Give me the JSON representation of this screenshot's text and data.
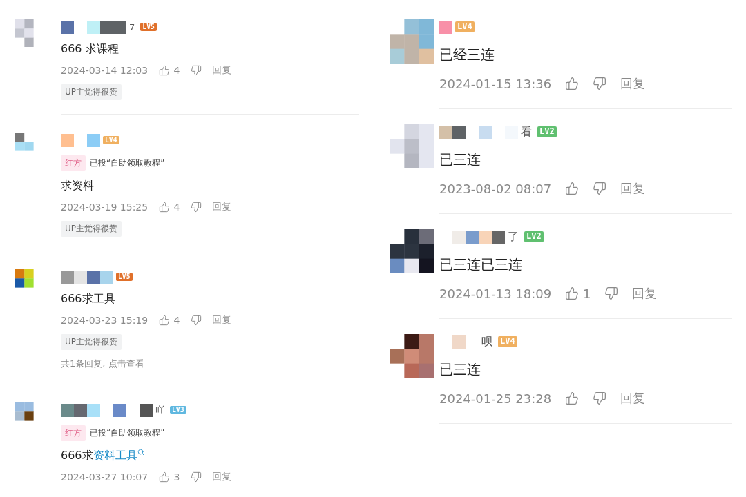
{
  "columns": [
    {
      "kind": "compact",
      "comments": [
        {
          "name_tail": "7",
          "level": {
            "label": "LV5",
            "color": "#e0702a"
          },
          "text": "666 求课程",
          "date": "2024-03-14 12:03",
          "likes": "4",
          "reply": "回复",
          "tag": "UP主觉得很赞"
        },
        {
          "level": {
            "label": "LV4",
            "color": "#f0b060"
          },
          "vote": {
            "side": "红方",
            "text": "已投“自助领取教程”"
          },
          "text": "求资料",
          "date": "2024-03-19 15:25",
          "likes": "4",
          "reply": "回复",
          "tag": "UP主觉得很赞"
        },
        {
          "level": {
            "label": "LV5",
            "color": "#e0702a"
          },
          "text": "666求工具",
          "date": "2024-03-23 15:19",
          "likes": "4",
          "reply": "回复",
          "tag": "UP主觉得很赞",
          "replies_link": "共1条回复, 点击查看"
        },
        {
          "name_tail": "吖",
          "level": {
            "label": "LV3",
            "color": "#60b8e0"
          },
          "vote": {
            "side": "红方",
            "text": "已投“自助领取教程”"
          },
          "text": "666求",
          "link": "资料工具",
          "date": "2024-03-27 10:07",
          "likes": "3",
          "reply": "回复"
        }
      ]
    },
    {
      "kind": "large",
      "comments": [
        {
          "level": {
            "label": "LV4",
            "color": "#f0b060"
          },
          "text": "已经三连",
          "date": "2024-01-15 13:36",
          "reply": "回复"
        },
        {
          "name_tail": "看",
          "level": {
            "label": "LV2",
            "color": "#60c070"
          },
          "text": "已三连",
          "date": "2023-08-02 08:07",
          "reply": "回复"
        },
        {
          "name_tail": "了",
          "level": {
            "label": "LV2",
            "color": "#60c070"
          },
          "text": "已三连已三连",
          "date": "2024-01-13 18:09",
          "likes": "1",
          "reply": "回复"
        },
        {
          "name_tail": "呗",
          "level": {
            "label": "LV4",
            "color": "#f0b060"
          },
          "text": "已三连",
          "date": "2024-01-25 23:28",
          "reply": "回复"
        }
      ]
    }
  ]
}
